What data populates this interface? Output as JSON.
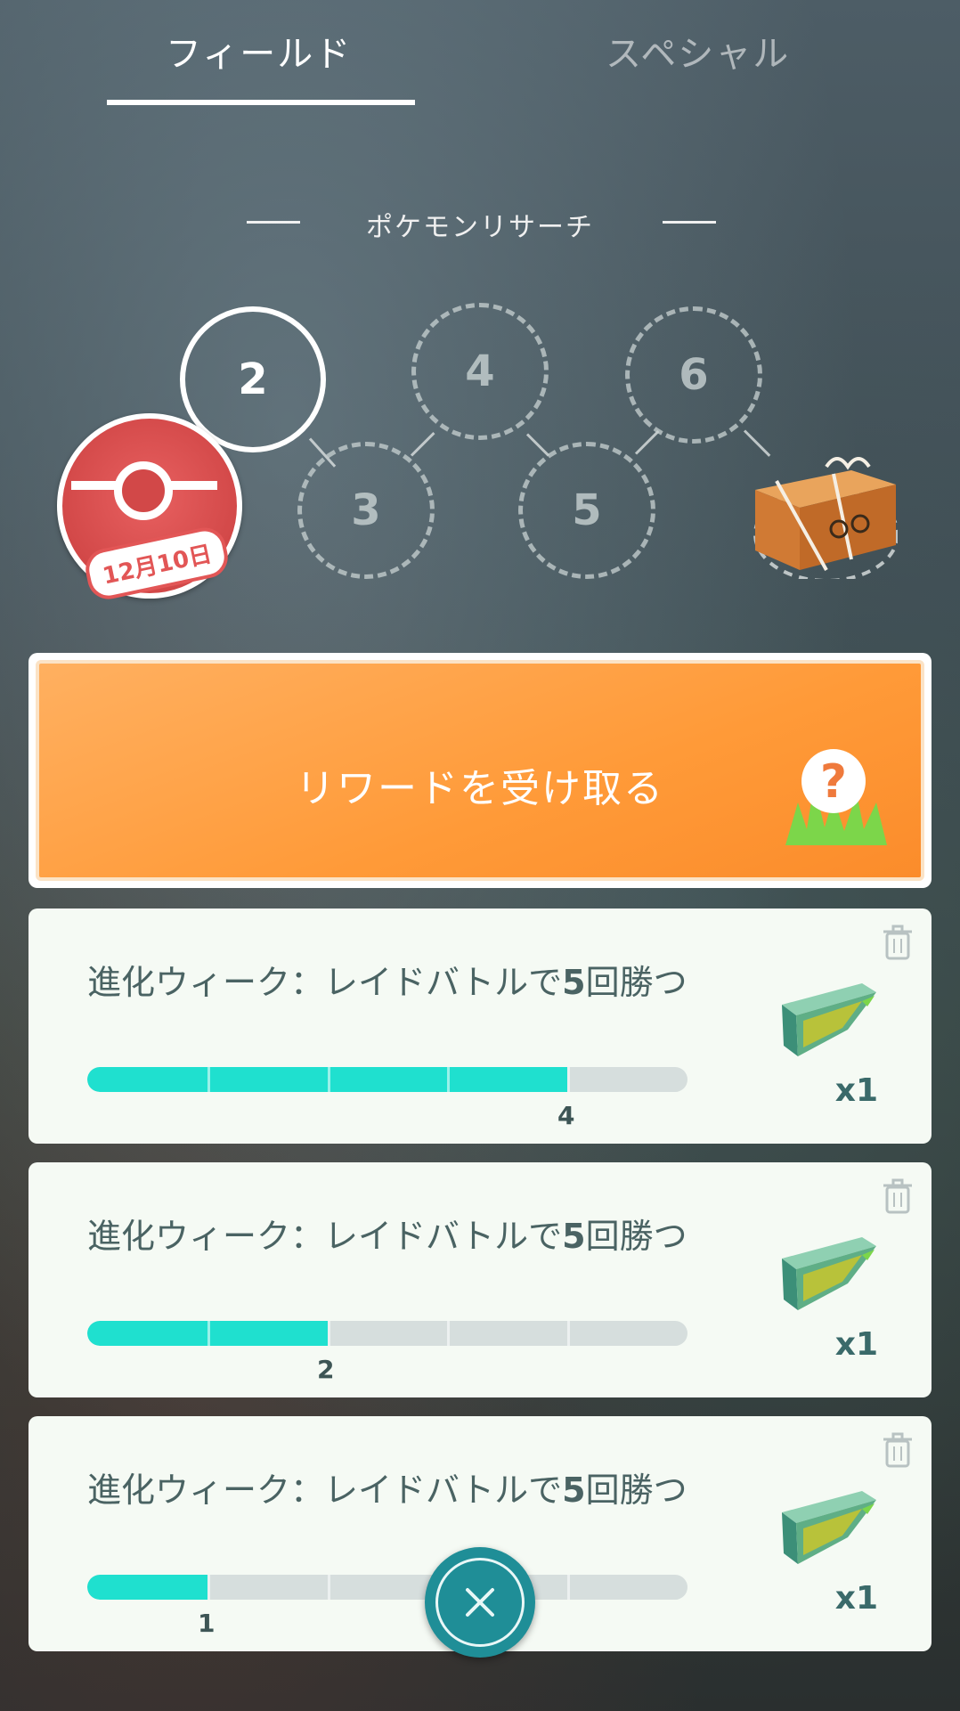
{
  "tabs": {
    "field": "フィールド",
    "special": "スペシャル",
    "active": "field"
  },
  "research": {
    "title": "ポケモンリサーチ",
    "current_stage": "2",
    "stages": [
      "2",
      "3",
      "4",
      "5",
      "6"
    ],
    "stamp_date": "12月10日"
  },
  "reward_button": {
    "label": "リワードを受け取る",
    "icon": "mystery-question-icon"
  },
  "tasks": [
    {
      "title_a": "進化ウィーク：レイドバトルで",
      "title_num": "5",
      "title_b": "回勝つ",
      "progress": 4,
      "goal": 5,
      "progress_label": "4",
      "reward_icon": "premium-raid-pass-icon",
      "reward_qty": "x1"
    },
    {
      "title_a": "進化ウィーク：レイドバトルで",
      "title_num": "5",
      "title_b": "回勝つ",
      "progress": 2,
      "goal": 5,
      "progress_label": "2",
      "reward_icon": "premium-raid-pass-icon",
      "reward_qty": "x1"
    },
    {
      "title_a": "進化ウィーク：レイドバトルで",
      "title_num": "5",
      "title_b": "回勝つ",
      "progress": 1,
      "goal": 5,
      "progress_label": "1",
      "reward_icon": "premium-raid-pass-icon",
      "reward_qty": "x1"
    }
  ],
  "colors": {
    "progress_fill": "#1fe0cf",
    "reward_orange": "#ff9a38",
    "close_teal": "#1f8e97"
  }
}
